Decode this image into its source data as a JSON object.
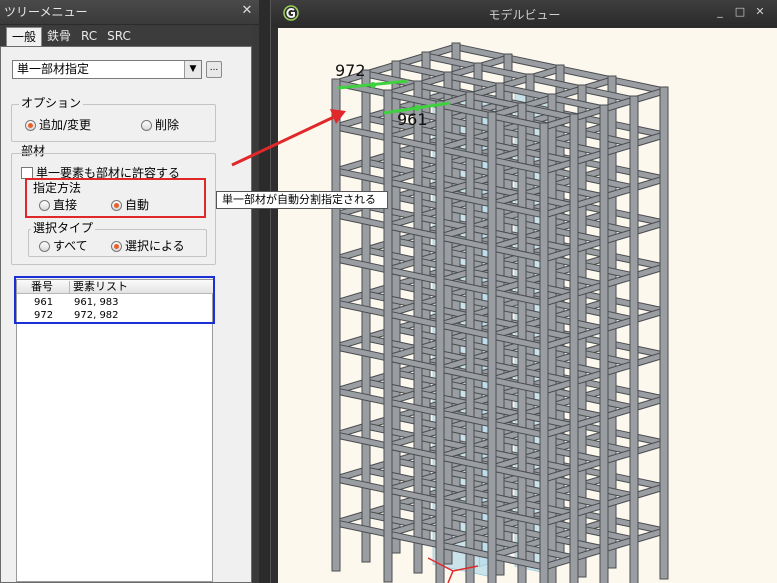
{
  "panel": {
    "title": "ツリーメニュー",
    "close_glyph": "✕",
    "tabs": [
      "一般",
      "鉄骨",
      "RC",
      "SRC"
    ],
    "active_tab": 0
  },
  "member_select": {
    "value": "単一部材指定",
    "arrow_glyph": "▼",
    "more_label": "..."
  },
  "options_group": {
    "label": "オプション",
    "add_change": "追加/変更",
    "delete": "削除",
    "selected": "追加/変更"
  },
  "member_group": {
    "label": "部材",
    "allow_single_element": "単一要素も部材に許容する",
    "allow_single_checked": false,
    "method": {
      "label": "指定方法",
      "direct": "直接",
      "auto": "自動",
      "selected": "自動"
    },
    "select_type": {
      "label": "選択タイプ",
      "all": "すべて",
      "by_selection": "選択による",
      "selected": "選択による"
    }
  },
  "member_table": {
    "headers": [
      "番号",
      "要素リスト"
    ],
    "rows": [
      {
        "id": "961",
        "elements": "961, 983"
      },
      {
        "id": "972",
        "elements": "972, 982"
      }
    ]
  },
  "model_view": {
    "title": "モデルビュー",
    "label_972": "972",
    "label_961": "961",
    "tooltip": "単一部材が自動分割指定される",
    "win_buttons": [
      "_",
      "□",
      "✕"
    ]
  },
  "colors": {
    "highlight_member": "#3fd13f",
    "annotation_red": "#e0282a",
    "annotation_blue": "#1a2fd6",
    "radio_on": "#e8602c",
    "wall_panel": "#b8dcea",
    "frame_gray": "#9a9ea2",
    "viewport_bg": "#fdf8ee"
  }
}
